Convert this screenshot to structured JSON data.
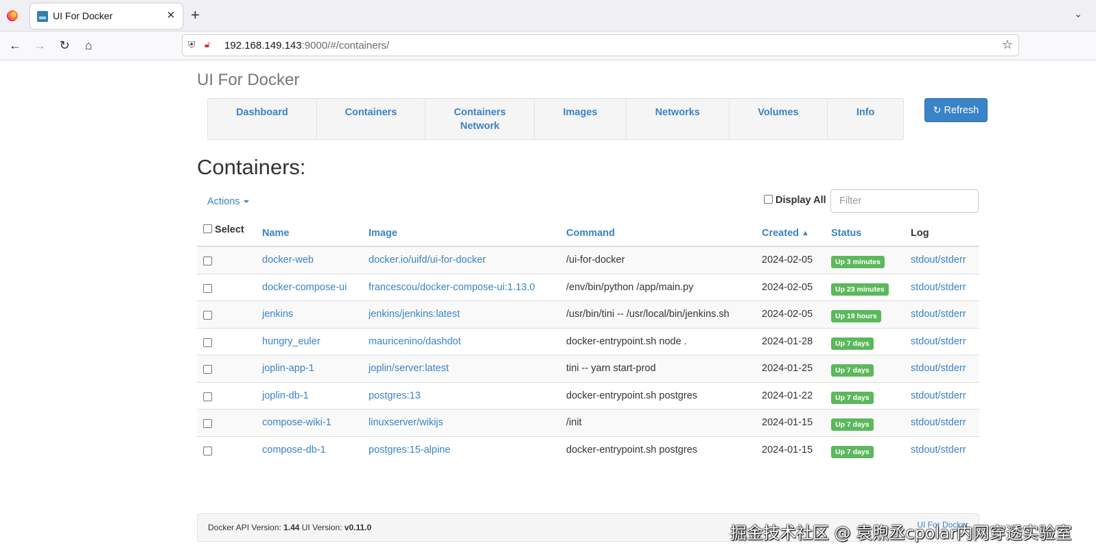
{
  "browser": {
    "tab_title": "UI For Docker",
    "tab_close": "✕",
    "new_tab": "+",
    "url_host": "192.168.149.143",
    "url_rest": ":9000/#/containers/"
  },
  "app": {
    "brand": "UI For Docker",
    "nav": [
      "Dashboard",
      "Containers",
      "Containers Network",
      "Images",
      "Networks",
      "Volumes",
      "Info"
    ],
    "refresh_label": "Refresh"
  },
  "containers": {
    "title": "Containers:",
    "actions_label": "Actions",
    "display_all_label": "Display All",
    "filter_placeholder": "Filter",
    "headers": {
      "select": "Select",
      "name": "Name",
      "image": "Image",
      "command": "Command",
      "created": "Created",
      "status": "Status",
      "log": "Log"
    },
    "rows": [
      {
        "name": "docker-web",
        "image": "docker.io/uifd/ui-for-docker",
        "command": "/ui-for-docker",
        "created": "2024-02-05",
        "status": "Up 3 minutes",
        "log": "stdout/stderr"
      },
      {
        "name": "docker-compose-ui",
        "image": "francescou/docker-compose-ui:1.13.0",
        "command": "/env/bin/python /app/main.py",
        "created": "2024-02-05",
        "status": "Up 23 minutes",
        "log": "stdout/stderr"
      },
      {
        "name": "jenkins",
        "image": "jenkins/jenkins:latest",
        "command": "/usr/bin/tini -- /usr/local/bin/jenkins.sh",
        "created": "2024-02-05",
        "status": "Up 19 hours",
        "log": "stdout/stderr"
      },
      {
        "name": "hungry_euler",
        "image": "mauricenino/dashdot",
        "command": "docker-entrypoint.sh node .",
        "created": "2024-01-28",
        "status": "Up 7 days",
        "log": "stdout/stderr"
      },
      {
        "name": "joplin-app-1",
        "image": "joplin/server:latest",
        "command": "tini -- yarn start-prod",
        "created": "2024-01-25",
        "status": "Up 7 days",
        "log": "stdout/stderr"
      },
      {
        "name": "joplin-db-1",
        "image": "postgres:13",
        "command": "docker-entrypoint.sh postgres",
        "created": "2024-01-22",
        "status": "Up 7 days",
        "log": "stdout/stderr"
      },
      {
        "name": "compose-wiki-1",
        "image": "linuxserver/wikijs",
        "command": "/init",
        "created": "2024-01-15",
        "status": "Up 7 days",
        "log": "stdout/stderr"
      },
      {
        "name": "compose-db-1",
        "image": "postgres:15-alpine",
        "command": "docker-entrypoint.sh postgres",
        "created": "2024-01-15",
        "status": "Up 7 days",
        "log": "stdout/stderr"
      }
    ]
  },
  "footer": {
    "api_label": "Docker API Version:",
    "api_version": "1.44",
    "ui_label": "UI Version:",
    "ui_version": "v0.11.0",
    "right_link": "UI For Docker"
  },
  "watermark": "掘金技术社区 @ 袁煦丞cpolar内网穿透实验室",
  "colors": {
    "link": "#3a83c4",
    "primary_button": "#3a83c8",
    "status_badge": "#5cb85c"
  }
}
